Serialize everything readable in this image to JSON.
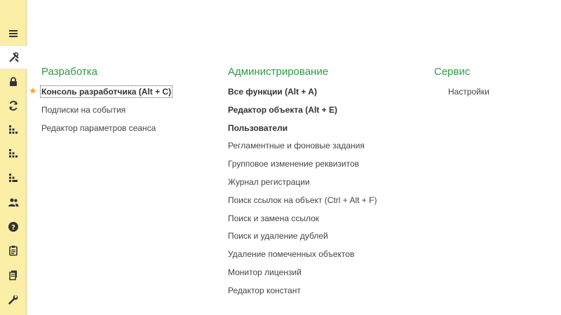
{
  "sections": {
    "development": {
      "title": "Разработка",
      "items": [
        "Консоль разработчика (Alt + C)",
        "Подписки на события",
        "Редактор параметров сеанса"
      ]
    },
    "administration": {
      "title": "Администрирование",
      "items": [
        "Все функции (Alt + A)",
        "Редактор объекта (Alt + E)",
        "Пользователи",
        "Регламентные и фоновые задания",
        "Групповое изменение реквизитов",
        "Журнал регистрации",
        "Поиск ссылок на объект (Ctrl + Alt + F)",
        "Поиск и замена ссылок",
        "Поиск и удаление дублей",
        "Удаление помеченных объектов",
        "Монитор лицензий",
        "Редактор констант"
      ]
    },
    "service": {
      "title": "Сервис",
      "items": [
        "Настройки"
      ]
    }
  },
  "sidebar_icons": [
    "menu-icon",
    "tools-icon",
    "lock-icon",
    "refresh-icon",
    "hierarchy-icon",
    "structure-icon",
    "structure-alt-icon",
    "users-icon",
    "help-icon",
    "clipboard-icon",
    "documents-icon",
    "wrench-icon"
  ],
  "colors": {
    "section_title": "#2f9a46",
    "sidebar_bg": "#fbeea6",
    "favorite_star": "#f5a623"
  }
}
